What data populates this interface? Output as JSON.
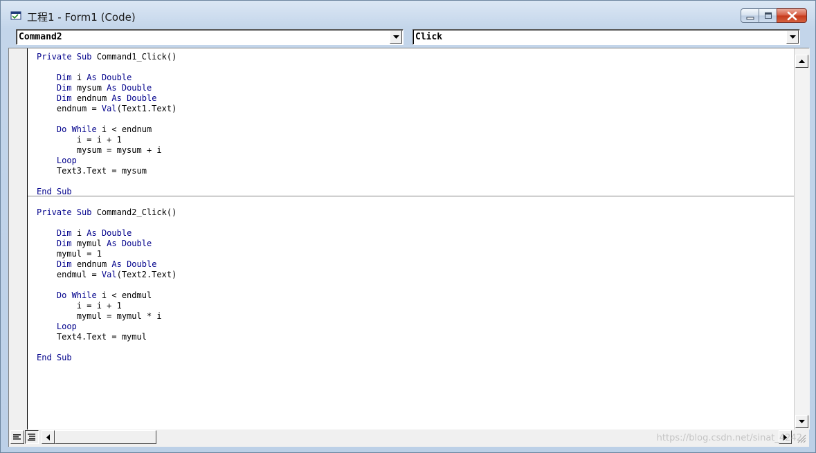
{
  "window": {
    "title": "工程1 - Form1 (Code)",
    "icon": "vb-project-window-icon",
    "buttons": [
      "minimize-icon",
      "maximize-icon",
      "close-icon"
    ]
  },
  "object_combo": {
    "selected": "Command2"
  },
  "procedure_combo": {
    "selected": "Click"
  },
  "code": {
    "keyword_color": "#00008b",
    "procedures": [
      {
        "lines": [
          [
            {
              "t": "Private Sub",
              "k": true
            },
            {
              "t": " Command1_Click()"
            }
          ],
          [],
          [
            {
              "t": "    "
            },
            {
              "t": "Dim",
              "k": true
            },
            {
              "t": " i "
            },
            {
              "t": "As Double",
              "k": true
            }
          ],
          [
            {
              "t": "    "
            },
            {
              "t": "Dim",
              "k": true
            },
            {
              "t": " mysum "
            },
            {
              "t": "As Double",
              "k": true
            }
          ],
          [
            {
              "t": "    "
            },
            {
              "t": "Dim",
              "k": true
            },
            {
              "t": " endnum "
            },
            {
              "t": "As Double",
              "k": true
            }
          ],
          [
            {
              "t": "    endnum = "
            },
            {
              "t": "Val",
              "k": true
            },
            {
              "t": "(Text1.Text)"
            }
          ],
          [],
          [
            {
              "t": "    "
            },
            {
              "t": "Do While",
              "k": true
            },
            {
              "t": " i < endnum"
            }
          ],
          [
            {
              "t": "        i = i + 1"
            }
          ],
          [
            {
              "t": "        mysum = mysum + i"
            }
          ],
          [
            {
              "t": "    "
            },
            {
              "t": "Loop",
              "k": true
            }
          ],
          [
            {
              "t": "    Text3.Text = mysum"
            }
          ],
          [],
          [
            {
              "t": "End Sub",
              "k": true
            }
          ]
        ]
      },
      {
        "lines": [
          [
            {
              "t": "Private Sub",
              "k": true
            },
            {
              "t": " Command2_Click()"
            }
          ],
          [],
          [
            {
              "t": "    "
            },
            {
              "t": "Dim",
              "k": true
            },
            {
              "t": " i "
            },
            {
              "t": "As Double",
              "k": true
            }
          ],
          [
            {
              "t": "    "
            },
            {
              "t": "Dim",
              "k": true
            },
            {
              "t": " mymul "
            },
            {
              "t": "As Double",
              "k": true
            }
          ],
          [
            {
              "t": "    mymul = 1"
            }
          ],
          [
            {
              "t": "    "
            },
            {
              "t": "Dim",
              "k": true
            },
            {
              "t": " endnum "
            },
            {
              "t": "As Double",
              "k": true
            }
          ],
          [
            {
              "t": "    endmul = "
            },
            {
              "t": "Val",
              "k": true
            },
            {
              "t": "(Text2.Text)"
            }
          ],
          [],
          [
            {
              "t": "    "
            },
            {
              "t": "Do While",
              "k": true
            },
            {
              "t": " i < endmul"
            }
          ],
          [
            {
              "t": "        i = i + 1"
            }
          ],
          [
            {
              "t": "        mymul = mymul * i"
            }
          ],
          [
            {
              "t": "    "
            },
            {
              "t": "Loop",
              "k": true
            }
          ],
          [
            {
              "t": "    Text4.Text = mymul"
            }
          ],
          [],
          [
            {
              "t": "End Sub",
              "k": true
            }
          ]
        ]
      }
    ]
  },
  "bottom": {
    "view_buttons": [
      "procedure-view-icon",
      "full-module-view-icon"
    ],
    "watermark": "https://blog.csdn.net/sinat_4242"
  }
}
